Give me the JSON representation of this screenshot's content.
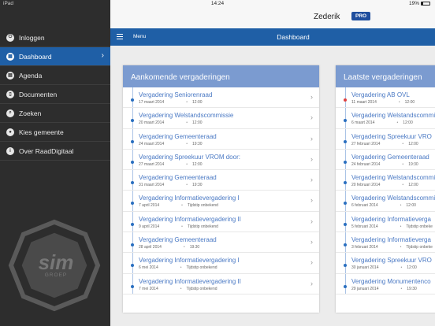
{
  "status": {
    "device": "iPad",
    "time": "14:24",
    "battery": "19%"
  },
  "header": {
    "title": "Zederik",
    "badge": "PRO"
  },
  "navbar": {
    "menu_label": "Menu",
    "title": "Dashboard"
  },
  "sidebar": {
    "items": [
      {
        "label": "Inloggen",
        "icon": "power-icon",
        "active": false
      },
      {
        "label": "Dashboard",
        "icon": "grid-icon",
        "active": true
      },
      {
        "label": "Agenda",
        "icon": "calendar-icon",
        "active": false
      },
      {
        "label": "Documenten",
        "icon": "document-icon",
        "active": false
      },
      {
        "label": "Zoeken",
        "icon": "search-icon",
        "active": false
      },
      {
        "label": "Kies gemeente",
        "icon": "location-pin-icon",
        "active": false
      },
      {
        "label": "Over RaadDigitaal",
        "icon": "info-icon",
        "active": false
      }
    ],
    "logo": {
      "text": "sim",
      "subtext": "GROEP"
    }
  },
  "upcoming": {
    "title": "Aankomende vergaderingen",
    "items": [
      {
        "name": "Vergadering Seniorenraad",
        "date": "17 maart 2014",
        "time": "12:00"
      },
      {
        "name": "Vergadering Welstandscommissie",
        "date": "20 maart 2014",
        "time": "12:00"
      },
      {
        "name": "Vergadering Gemeenteraad",
        "date": "24 maart 2014",
        "time": "19:30"
      },
      {
        "name": "Vergadering Spreekuur VROM door:",
        "date": "27 maart 2014",
        "time": "12:00"
      },
      {
        "name": "Vergadering Gemeenteraad",
        "date": "31 maart 2014",
        "time": "19:30"
      },
      {
        "name": "Vergadering Informatievergadering I",
        "date": "7 april 2014",
        "time": "Tijdstip onbekend"
      },
      {
        "name": "Vergadering Informatievergadering II",
        "date": "9 april 2014",
        "time": "Tijdstip onbekend"
      },
      {
        "name": "Vergadering Gemeenteraad",
        "date": "28 april 2014",
        "time": "19:30"
      },
      {
        "name": "Vergadering Informatievergadering I",
        "date": "6 mei 2014",
        "time": "Tijdstip onbekend"
      },
      {
        "name": "Vergadering Informatievergadering II",
        "date": "7 mei 2014",
        "time": "Tijdstip onbekend"
      }
    ]
  },
  "latest": {
    "title": "Laatste vergaderingen",
    "items": [
      {
        "name": "Vergadering AB OVL",
        "date": "11 maart 2014",
        "time": "12:00"
      },
      {
        "name": "Vergadering Welstandscommi",
        "date": "6 maart 2014",
        "time": "12:00"
      },
      {
        "name": "Vergadering Spreekuur VRO",
        "date": "27 februari 2014",
        "time": "12:00"
      },
      {
        "name": "Vergadering Gemeenteraad",
        "date": "24 februari 2014",
        "time": "19:30"
      },
      {
        "name": "Vergadering Welstandscommi",
        "date": "20 februari 2014",
        "time": "12:00"
      },
      {
        "name": "Vergadering Welstandscommi",
        "date": "6 februari 2014",
        "time": "12:00"
      },
      {
        "name": "Vergadering Informatieverga",
        "date": "5 februari 2014",
        "time": "Tijdstip onbeke"
      },
      {
        "name": "Vergadering Informatieverga",
        "date": "3 februari 2014",
        "time": "Tijdstip onbeke"
      },
      {
        "name": "Vergadering Spreekuur VRO",
        "date": "30 januari 2014",
        "time": "12:00"
      },
      {
        "name": "Vergadering Monumentenco",
        "date": "29 januari 2014",
        "time": "19:30"
      }
    ]
  }
}
